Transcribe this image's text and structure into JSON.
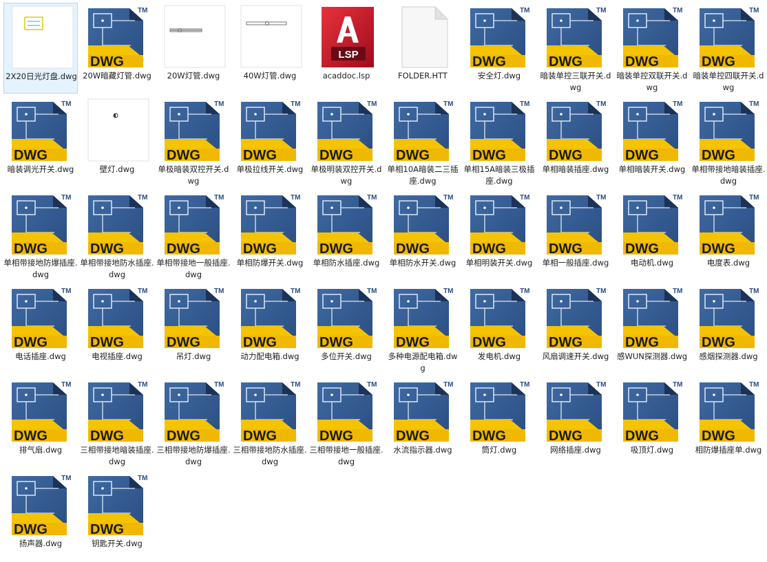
{
  "files": [
    {
      "name": "2X20日光灯盘.dwg",
      "type": "thumb-panel",
      "selected": true
    },
    {
      "name": "20W暗藏灯管.dwg",
      "type": "dwg"
    },
    {
      "name": "20W灯管.dwg",
      "type": "thumb-tube-short"
    },
    {
      "name": "40W灯管.dwg",
      "type": "thumb-tube-long"
    },
    {
      "name": "acaddoc.lsp",
      "type": "lsp"
    },
    {
      "name": "FOLDER.HTT",
      "type": "blank"
    },
    {
      "name": "安全灯.dwg",
      "type": "dwg"
    },
    {
      "name": "暗装单控三联开关.dwg",
      "type": "dwg"
    },
    {
      "name": "暗装单控双联开关.dwg",
      "type": "dwg"
    },
    {
      "name": "暗装单控四联开关.dwg",
      "type": "dwg"
    },
    {
      "name": "暗装调光开关.dwg",
      "type": "dwg"
    },
    {
      "name": "壁灯.dwg",
      "type": "thumb-wall-lamp"
    },
    {
      "name": "单极暗装双控开关.dwg",
      "type": "dwg"
    },
    {
      "name": "单极拉线开关.dwg",
      "type": "dwg"
    },
    {
      "name": "单极明装双控开关.dwg",
      "type": "dwg"
    },
    {
      "name": "单相10A暗装二三插座.dwg",
      "type": "dwg"
    },
    {
      "name": "单相15A暗装三极插座.dwg",
      "type": "dwg"
    },
    {
      "name": "单相暗装插座.dwg",
      "type": "dwg"
    },
    {
      "name": "单相暗装开关.dwg",
      "type": "dwg"
    },
    {
      "name": "单相带接地暗装插座.dwg",
      "type": "dwg"
    },
    {
      "name": "单相带接地防爆插座.dwg",
      "type": "dwg"
    },
    {
      "name": "单相带接地防水插座.dwg",
      "type": "dwg"
    },
    {
      "name": "单相带接地一般插座.dwg",
      "type": "dwg"
    },
    {
      "name": "单相防爆开关.dwg",
      "type": "dwg"
    },
    {
      "name": "单相防水插座.dwg",
      "type": "dwg"
    },
    {
      "name": "单相防水开关.dwg",
      "type": "dwg"
    },
    {
      "name": "单相明装开关.dwg",
      "type": "dwg"
    },
    {
      "name": "单相一般插座.dwg",
      "type": "dwg"
    },
    {
      "name": "电动机.dwg",
      "type": "dwg"
    },
    {
      "name": "电度表.dwg",
      "type": "dwg"
    },
    {
      "name": "电话插座.dwg",
      "type": "dwg"
    },
    {
      "name": "电视插座.dwg",
      "type": "dwg"
    },
    {
      "name": "吊灯.dwg",
      "type": "dwg"
    },
    {
      "name": "动力配电箱.dwg",
      "type": "dwg"
    },
    {
      "name": "多位开关.dwg",
      "type": "dwg"
    },
    {
      "name": "多种电源配电箱.dwg",
      "type": "dwg"
    },
    {
      "name": "发电机.dwg",
      "type": "dwg"
    },
    {
      "name": "风扇调速开关.dwg",
      "type": "dwg"
    },
    {
      "name": "感WUN探测器.dwg",
      "type": "dwg"
    },
    {
      "name": "感烟探测器.dwg",
      "type": "dwg"
    },
    {
      "name": "排气扇.dwg",
      "type": "dwg"
    },
    {
      "name": "三相带接地暗装插座.dwg",
      "type": "dwg"
    },
    {
      "name": "三相带接地防爆插座.dwg",
      "type": "dwg"
    },
    {
      "name": "三相带接地防水插座.dwg",
      "type": "dwg"
    },
    {
      "name": "三相带接地一般插座.dwg",
      "type": "dwg"
    },
    {
      "name": "水流指示器.dwg",
      "type": "dwg"
    },
    {
      "name": "筒灯.dwg",
      "type": "dwg"
    },
    {
      "name": "网络插座.dwg",
      "type": "dwg"
    },
    {
      "name": "吸顶灯.dwg",
      "type": "dwg"
    },
    {
      "name": "相防爆插座单.dwg",
      "type": "dwg"
    },
    {
      "name": "扬声器.dwg",
      "type": "dwg"
    },
    {
      "name": "钥匙开关.dwg",
      "type": "dwg"
    }
  ],
  "icon_text": {
    "dwg_badge": "DWG",
    "dwg_trademark": "TM",
    "lsp_badge": "LSP"
  },
  "colors": {
    "dwg_blue": "#2a4d80",
    "dwg_yellow": "#f4c400",
    "lsp_red": "#c8102e",
    "selection": "#e5f3ff"
  }
}
